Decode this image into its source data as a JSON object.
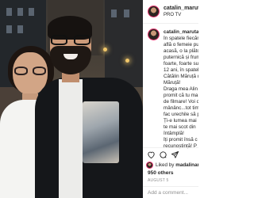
{
  "post": {
    "username": "catalin_maruta",
    "location": "PRO TV",
    "caption_user": "catalin_maruta",
    "caption_lines": [
      "În spatele fiecăr",
      "află o femeie pu",
      "acasă, o la plătc",
      "puternică și frum",
      "foarte, foarte su",
      "12 ani, în spatel",
      "Cătălin Măruță d",
      "Măruță!",
      "Draga mea Alin",
      "promit că tu ma",
      "de filmare! Voi c",
      "mânânc...tot tim",
      "fac urechile să p",
      "Ți-e lumea mai",
      "te mai scot din",
      "întâmplă!",
      "Îți promit însă c",
      "recunoștință! P"
    ],
    "liked_by_prefix": "Liked by",
    "liked_by_user": "madalinar",
    "others": "950 others",
    "date": "AUGUST 5",
    "add_comment_placeholder": "Add a comment..."
  },
  "icons": {
    "heart": "heart-icon",
    "comment": "comment-icon",
    "share": "share-icon"
  },
  "colors": {
    "story_ring": "#e1306c",
    "secondary_text": "#8e8e8e"
  }
}
